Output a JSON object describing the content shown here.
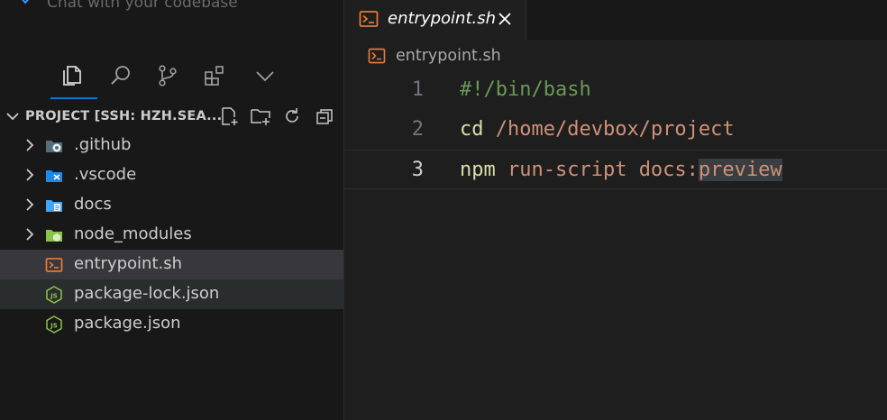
{
  "sidebar": {
    "top_partial_text": "Chat with your codebase",
    "activity_bar": [
      "explorer-icon",
      "search-icon",
      "source-control-icon",
      "extensions-icon",
      "chevron-down-icon"
    ],
    "explorer_title": "PROJECT [SSH: HZH.SEA...",
    "header_actions": [
      "new-file-icon",
      "new-folder-icon",
      "refresh-icon",
      "collapse-all-icon"
    ],
    "tree": [
      {
        "label": ".github",
        "type": "folder",
        "icon": "github-folder-icon"
      },
      {
        "label": ".vscode",
        "type": "folder",
        "icon": "vscode-folder-icon"
      },
      {
        "label": "docs",
        "type": "folder",
        "icon": "docs-folder-icon"
      },
      {
        "label": "node_modules",
        "type": "folder",
        "icon": "node-folder-icon"
      },
      {
        "label": "entrypoint.sh",
        "type": "file",
        "icon": "terminal-file-icon",
        "state": "selected"
      },
      {
        "label": "package-lock.json",
        "type": "file",
        "icon": "json-file-icon",
        "state": "hover"
      },
      {
        "label": "package.json",
        "type": "file",
        "icon": "json-file-icon"
      }
    ]
  },
  "editor": {
    "tab": {
      "label": "entrypoint.sh",
      "icon": "terminal-file-icon"
    },
    "breadcrumb": "entrypoint.sh",
    "current_line": 3,
    "lines": [
      {
        "num": "1",
        "tokens": [
          {
            "t": "#!/bin/bash",
            "c": "cm"
          }
        ]
      },
      {
        "num": "2",
        "tokens": [
          {
            "t": "cd",
            "c": "kw"
          },
          {
            "t": " /home/devbox/project",
            "c": "str"
          }
        ]
      },
      {
        "num": "3",
        "tokens": [
          {
            "t": "npm",
            "c": "kw"
          },
          {
            "t": " run-script docs:",
            "c": "str"
          },
          {
            "t": "preview",
            "c": "str sel"
          }
        ]
      }
    ]
  },
  "colors": {
    "accent": "#0078d4",
    "terminal_icon": "#e37933",
    "json_icon": "#8bc34a",
    "folder_blue": "#42a5f5",
    "folder_green": "#8bc34a"
  }
}
